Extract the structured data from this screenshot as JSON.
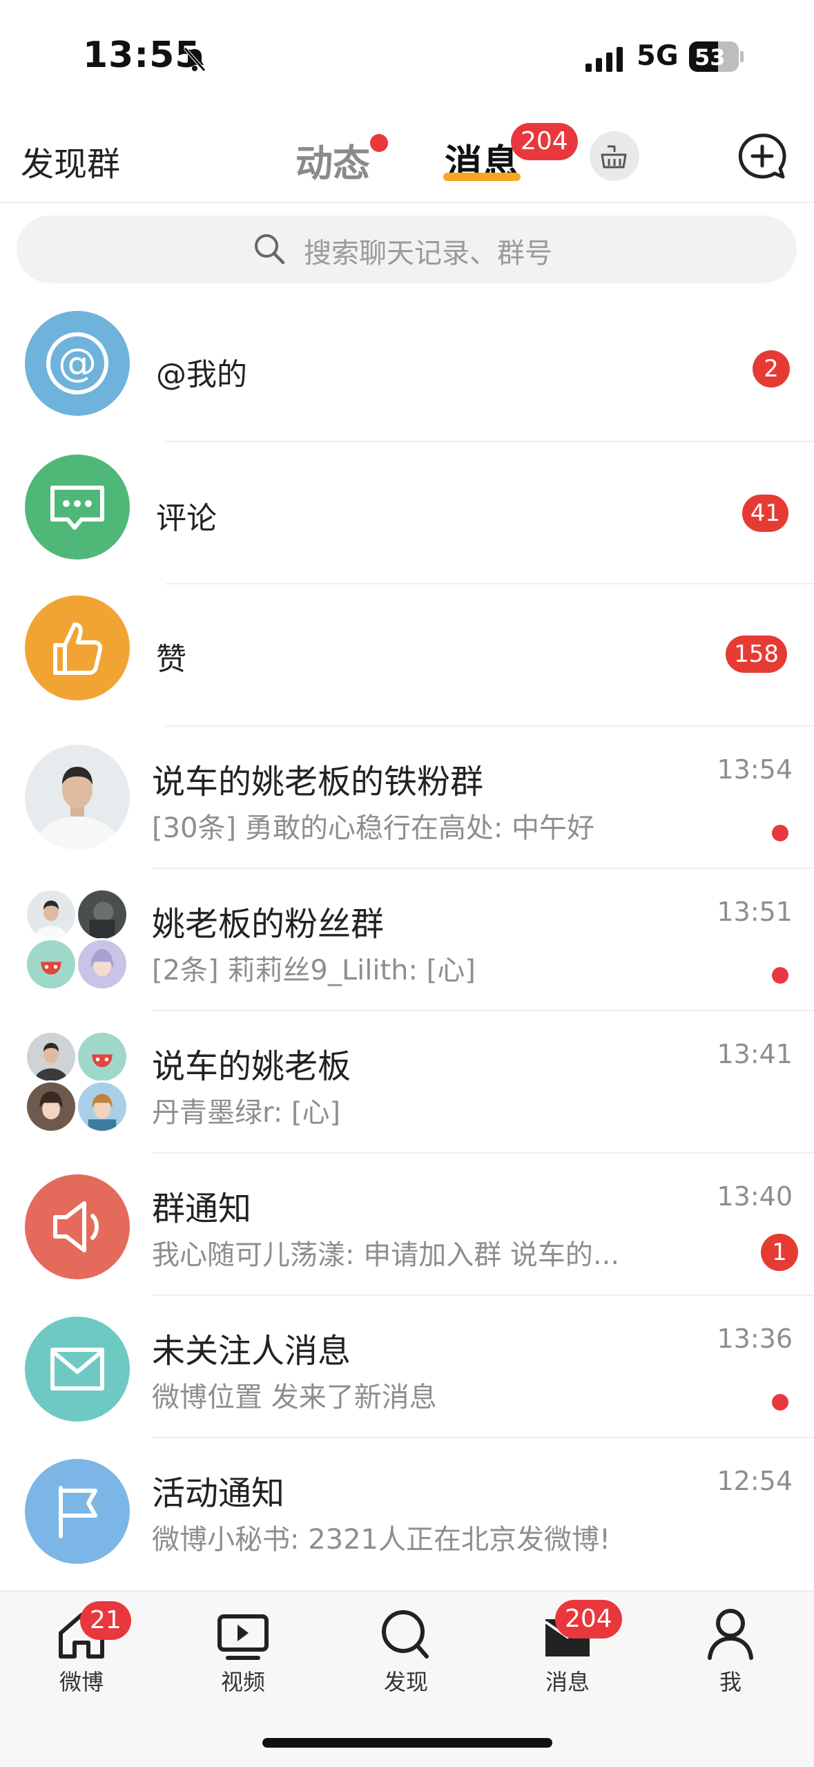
{
  "status_bar": {
    "time": "13:55",
    "network": "5G",
    "battery": "53"
  },
  "header": {
    "left_label": "发现群",
    "tabs": [
      {
        "label": "动态"
      },
      {
        "label": "消息",
        "badge": "204"
      }
    ]
  },
  "search": {
    "placeholder": "搜索聊天记录、群号"
  },
  "rows": [
    {
      "title": "@我的",
      "badge": "2",
      "avatar_color": "#6fb2dc",
      "icon": "at-icon"
    },
    {
      "title": "评论",
      "badge": "41",
      "avatar_color": "#4fb878",
      "icon": "comment-icon"
    },
    {
      "title": "赞",
      "badge": "158",
      "avatar_color": "#f1a433",
      "icon": "thumbs-up-icon"
    },
    {
      "title": "说车的姚老板的铁粉群",
      "subtitle": "[30条] 勇敢的心稳行在高处: 中午好",
      "time": "13:54",
      "unread_dot": true
    },
    {
      "title": "姚老板的粉丝群",
      "subtitle": "[2条] 莉莉丝9_Lilith: [心]",
      "time": "13:51",
      "unread_dot": true
    },
    {
      "title": "说车的姚老板",
      "subtitle": "丹青墨绿r: [心]",
      "time": "13:41"
    },
    {
      "title": "群通知",
      "subtitle": "我心随可儿荡漾: 申请加入群 说车的...",
      "time": "13:40",
      "badge": "1",
      "avatar_color": "#e46a5c",
      "icon": "speaker-icon"
    },
    {
      "title": "未关注人消息",
      "subtitle": "微博位置 发来了新消息",
      "time": "13:36",
      "unread_dot": true,
      "avatar_color": "#6ec9c3",
      "icon": "mail-icon"
    },
    {
      "title": "活动通知",
      "subtitle": "微博小秘书: 2321人正在北京发微博!",
      "time": "12:54",
      "avatar_color": "#7bb6e6",
      "icon": "flag-icon"
    }
  ],
  "tabbar": [
    {
      "label": "微博",
      "badge": "21",
      "icon": "home-icon"
    },
    {
      "label": "视频",
      "icon": "video-icon"
    },
    {
      "label": "发现",
      "icon": "search-icon"
    },
    {
      "label": "消息",
      "badge": "204",
      "icon": "message-icon"
    },
    {
      "label": "我",
      "icon": "person-icon"
    }
  ]
}
